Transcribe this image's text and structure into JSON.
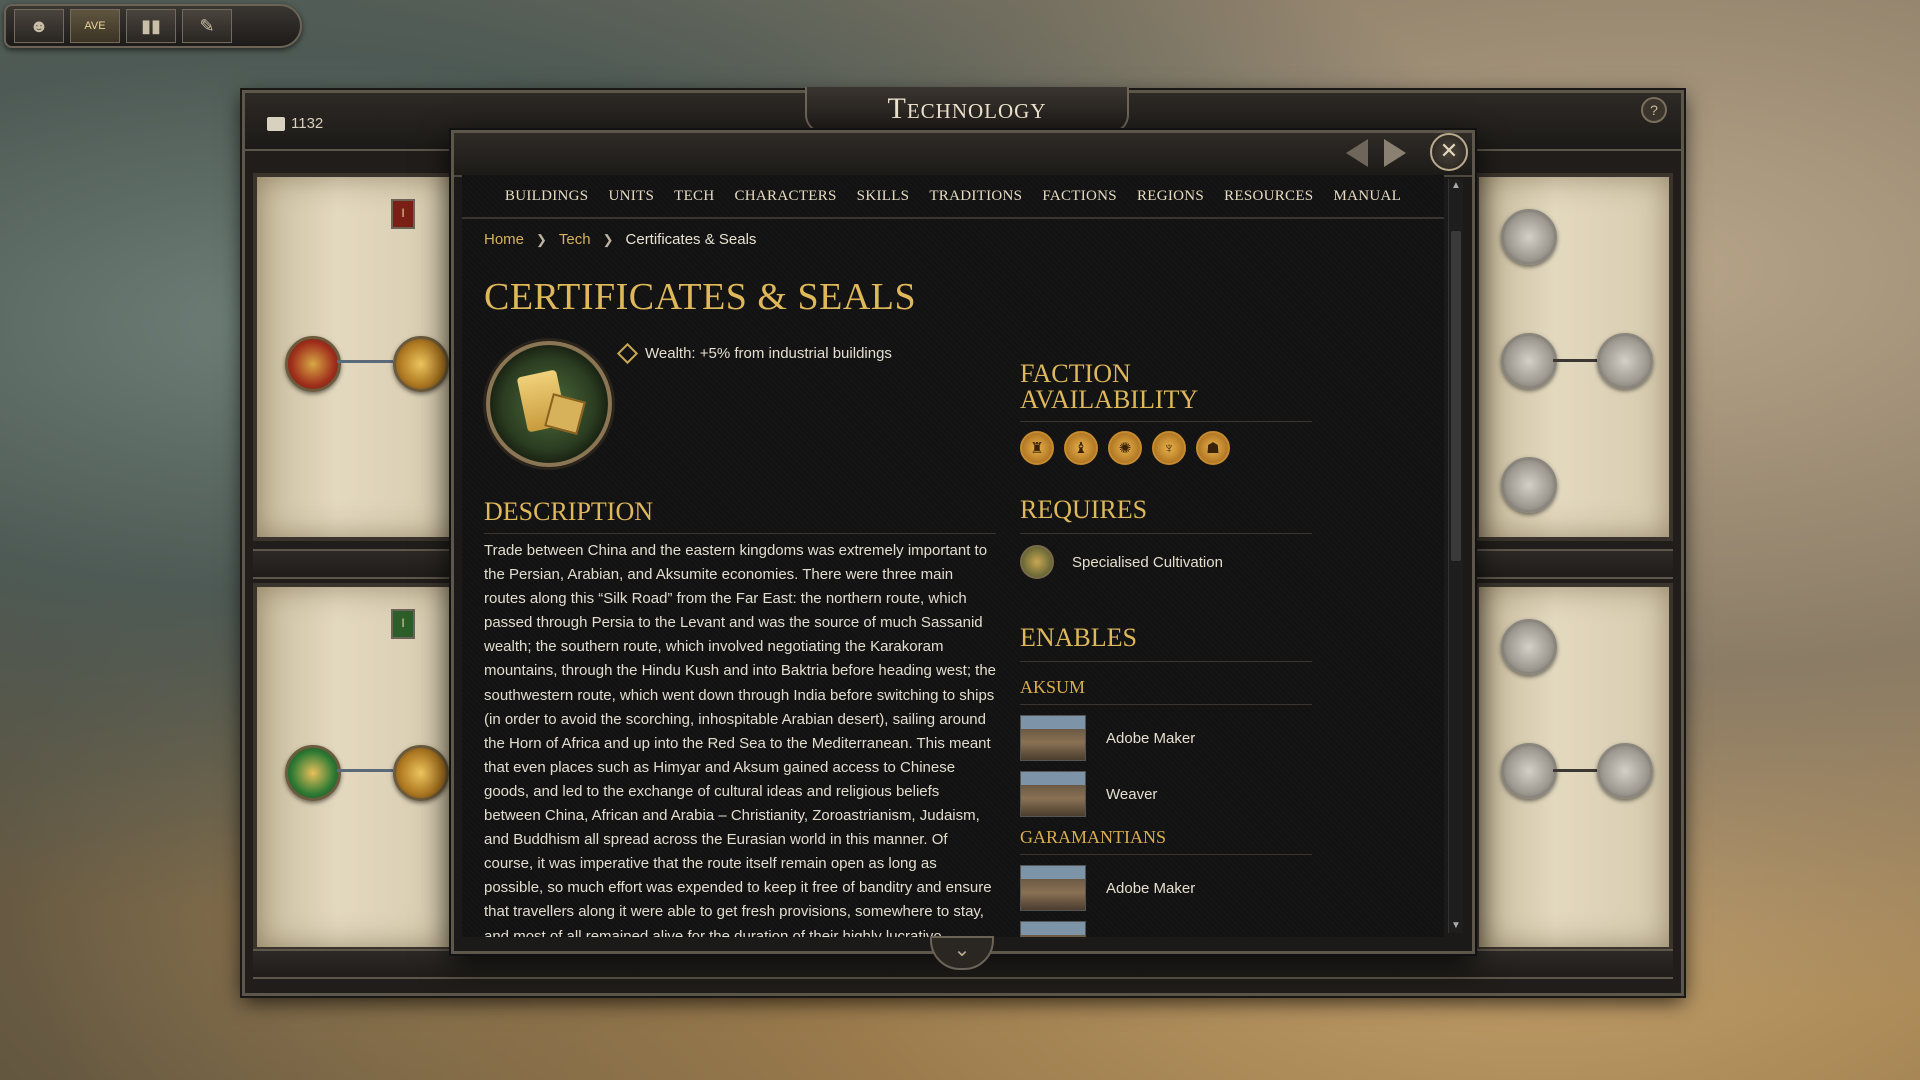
{
  "hud": {
    "buttons": [
      {
        "name": "portrait-icon",
        "glyph": "☻"
      },
      {
        "name": "ave-chat-icon",
        "glyph": "AVE"
      },
      {
        "name": "book-icon",
        "glyph": "❚❚"
      },
      {
        "name": "quill-icon",
        "glyph": "✎"
      }
    ]
  },
  "window": {
    "title": "Technology",
    "currency": "1132",
    "help": "?"
  },
  "encyclopedia": {
    "menu": [
      "BUILDINGS",
      "UNITS",
      "TECH",
      "CHARACTERS",
      "SKILLS",
      "TRADITIONS",
      "FACTIONS",
      "REGIONS",
      "RESOURCES",
      "MANUAL"
    ],
    "breadcrumb": {
      "home": "Home",
      "section": "Tech",
      "current": "Certificates & Seals"
    },
    "title": "CERTIFICATES & SEALS",
    "effect": "Wealth: +5% from industrial buildings",
    "description_heading": "DESCRIPTION",
    "description": "Trade between China and the eastern kingdoms was extremely important to the Persian, Arabian, and Aksumite economies. There were three main routes along this “Silk Road” from the Far East: the northern route, which passed through Persia to the Levant and was the source of much Sassanid wealth; the southern route, which involved negotiating the Karakoram mountains, through the Hindu Kush and into Baktria before heading west; the southwestern route, which went down through India before switching to ships (in order to avoid the scorching, inhospitable Arabian desert), sailing around the Horn of Africa and up into the Red Sea to the Mediterranean. This meant that even places such as Himyar and Aksum gained access to Chinese goods, and led to the exchange of cultural ideas and religious beliefs between China, African and Arabia – Christianity, Zoroastrianism, Judaism, and Buddhism all spread across the Eurasian world in this manner. Of course, it was imperative that the route itself remain open as long as possible, so much effort was expended to keep it free of banditry and ensure that travellers along it were able to get fresh provisions, somewhere to stay, and most of all remained alive for the duration of their highly lucrative journeys.",
    "faction_heading": "FACTION AVAILABILITY",
    "faction_icons": [
      "faction-icon-1",
      "faction-icon-2",
      "faction-icon-3",
      "faction-icon-4",
      "faction-icon-5"
    ],
    "requires_heading": "REQUIRES",
    "requires": "Specialised Cultivation",
    "enables_heading": "ENABLES",
    "aksum_heading": "AKSUM",
    "aksum_items": [
      "Adobe Maker",
      "Weaver"
    ],
    "garamantians_heading": "GARAMANTIANS",
    "garamantians_items": [
      "Adobe Maker"
    ],
    "close": "✕"
  },
  "colors": {
    "gold": "#dfb85a",
    "text": "#e3ddcf",
    "panel": "#121212"
  }
}
